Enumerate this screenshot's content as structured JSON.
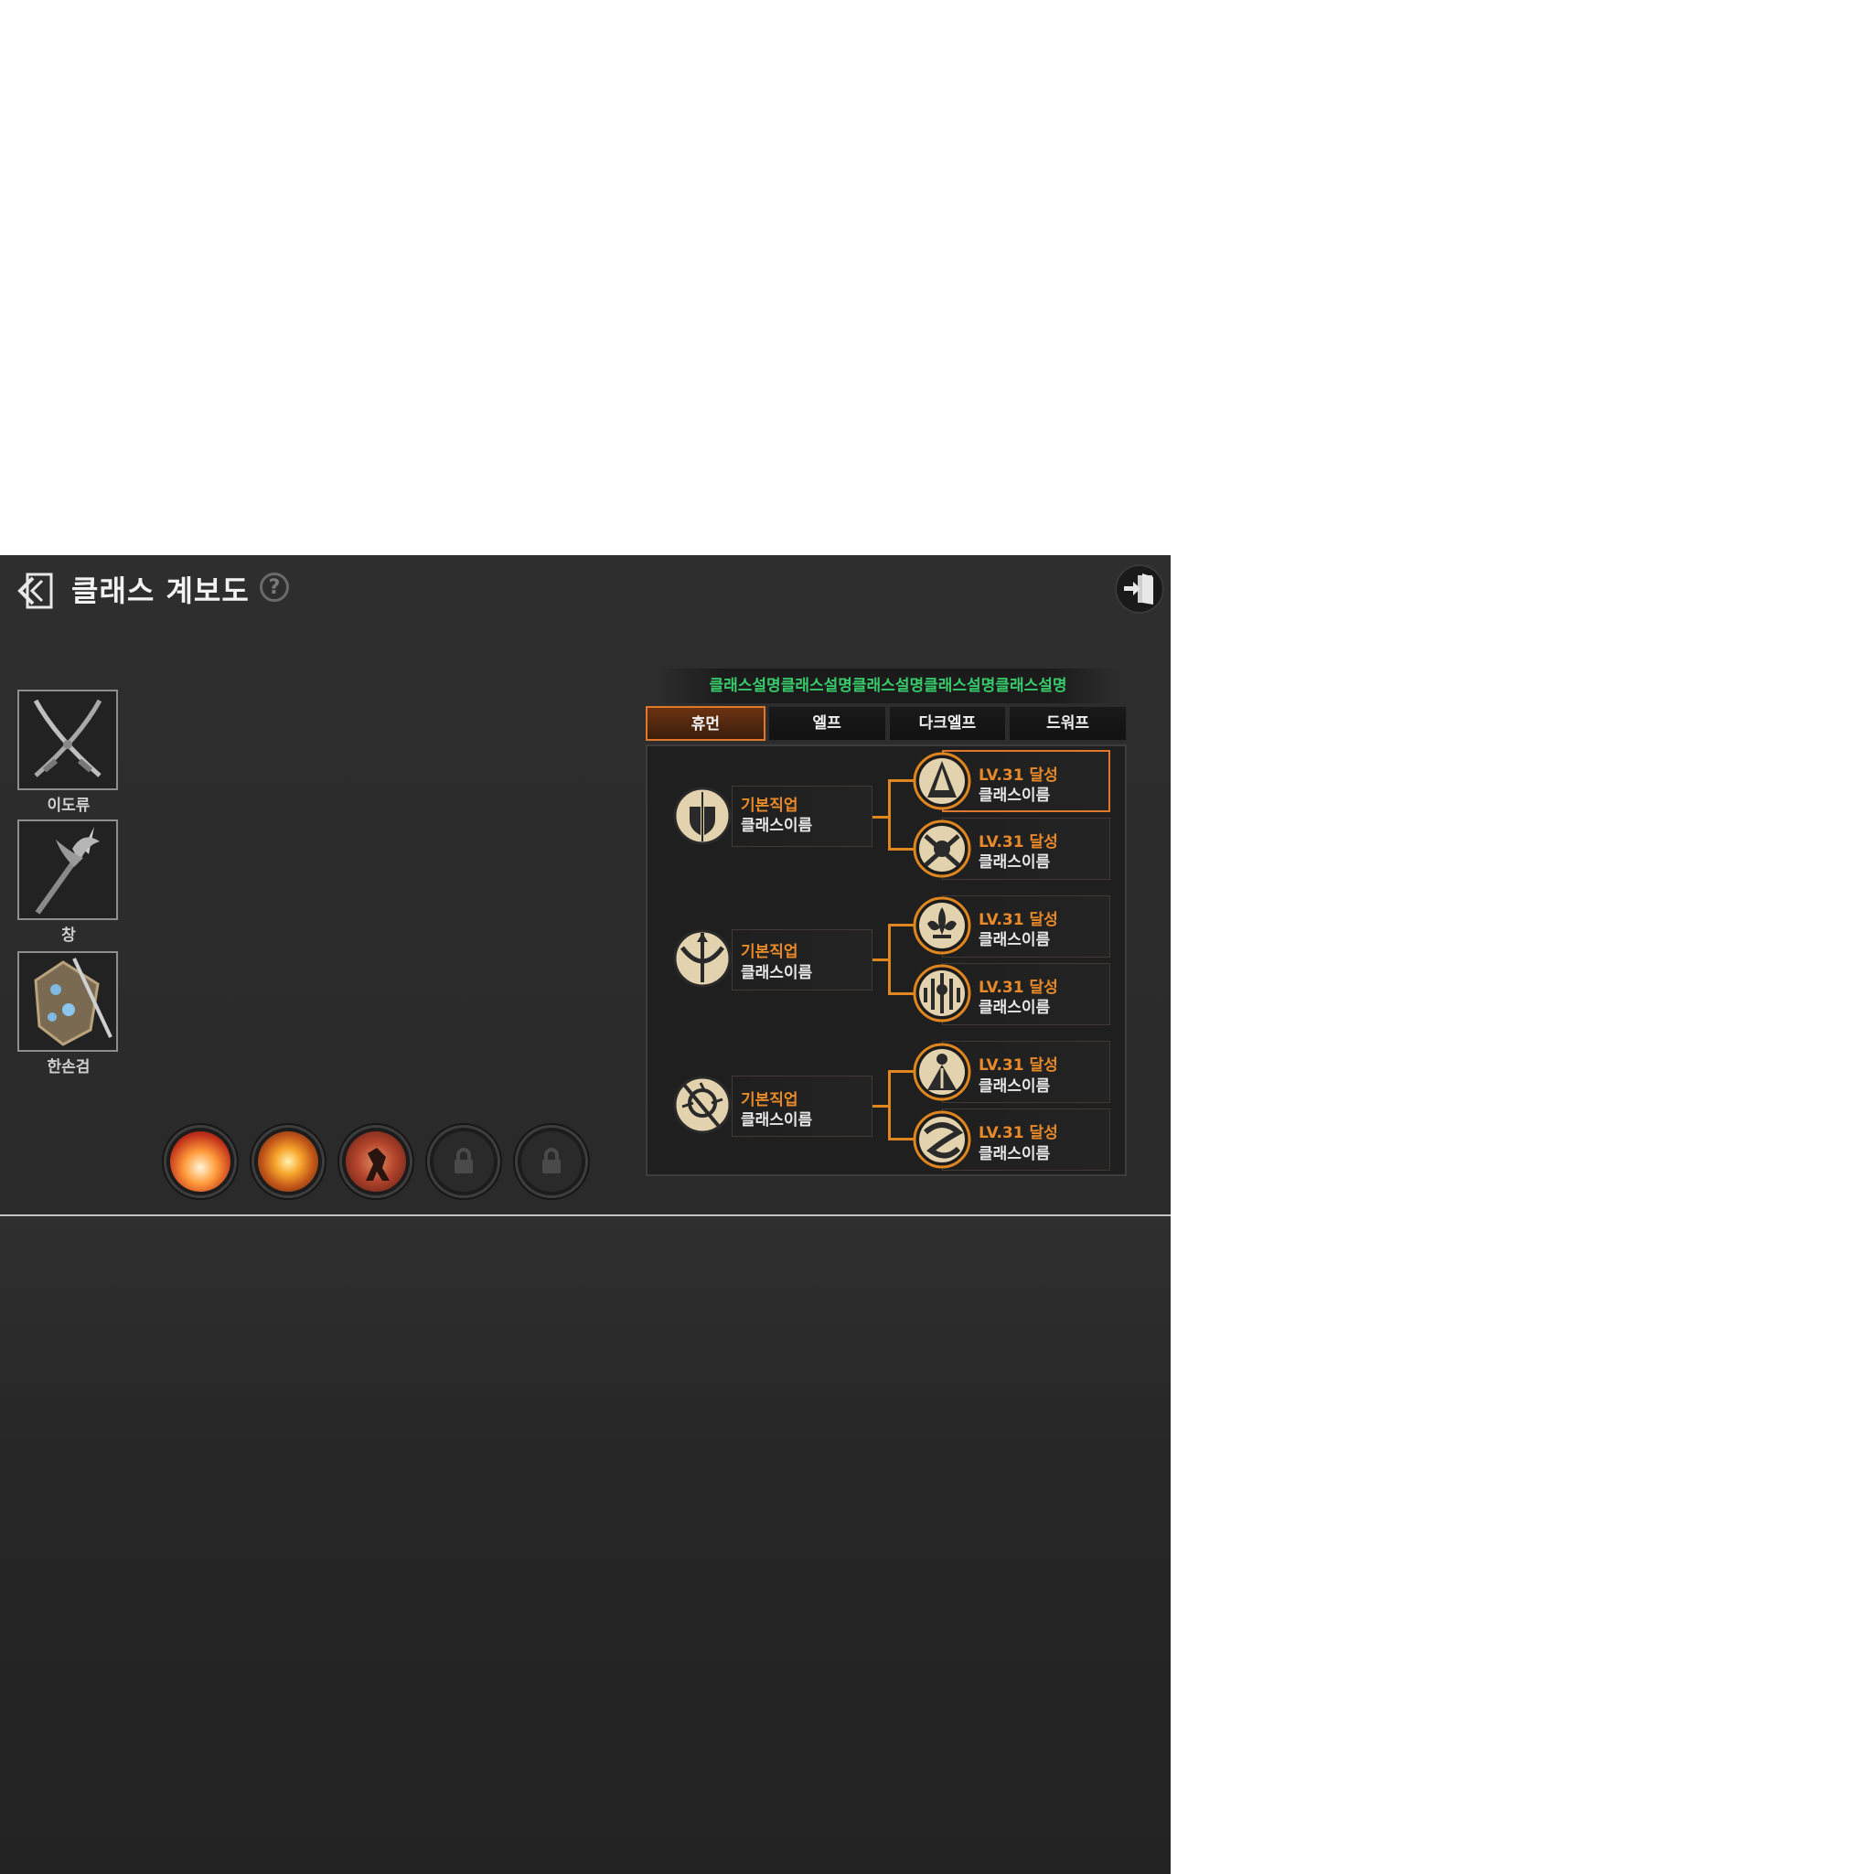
{
  "header": {
    "title": "클래스 계보도",
    "help_label": "?"
  },
  "weapons": [
    {
      "label": "이도류",
      "icon": "dual-swords-icon"
    },
    {
      "label": "창",
      "icon": "spear-icon"
    },
    {
      "label": "한손검",
      "icon": "one-hand-sword-icon"
    }
  ],
  "skills": [
    {
      "icon": "flame-burst-skill-icon",
      "locked": false
    },
    {
      "icon": "explosion-skill-icon",
      "locked": false
    },
    {
      "icon": "warrior-strike-skill-icon",
      "locked": false
    },
    {
      "icon": "lock-icon",
      "locked": true
    },
    {
      "icon": "lock-icon",
      "locked": true
    }
  ],
  "class_tree": {
    "description": "클래스설명클래스설명클래스설명클래스설명클래스설명",
    "tabs": [
      "휴먼",
      "엘프",
      "다크엘프",
      "드워프"
    ],
    "active_tab": "휴먼",
    "groups": [
      {
        "base": {
          "title": "기본직업",
          "name": "클래스이름",
          "icon": "sword-shield-emblem-icon"
        },
        "advanced": [
          {
            "title": "LV.31 달성",
            "name": "클래스이름",
            "icon": "hooded-figure-emblem-icon",
            "selected": true
          },
          {
            "title": "LV.31 달성",
            "name": "클래스이름",
            "icon": "crossed-blades-emblem-icon",
            "selected": false
          }
        ]
      },
      {
        "base": {
          "title": "기본직업",
          "name": "클래스이름",
          "icon": "bow-arrow-emblem-icon"
        },
        "advanced": [
          {
            "title": "LV.31 달성",
            "name": "클래스이름",
            "icon": "fleur-de-lis-emblem-icon",
            "selected": false
          },
          {
            "title": "LV.31 달성",
            "name": "클래스이름",
            "icon": "winged-crest-emblem-icon",
            "selected": false
          }
        ]
      },
      {
        "base": {
          "title": "기본직업",
          "name": "클래스이름",
          "icon": "mystic-staff-emblem-icon"
        },
        "advanced": [
          {
            "title": "LV.31 달성",
            "name": "클래스이름",
            "icon": "robed-mage-emblem-icon",
            "selected": false
          },
          {
            "title": "LV.31 달성",
            "name": "클래스이름",
            "icon": "serpent-coil-emblem-icon",
            "selected": false
          }
        ]
      }
    ]
  },
  "colors": {
    "accent_orange": "#e0772a",
    "description_green": "#37c96a",
    "panel_bg": "#2b2b2b"
  }
}
